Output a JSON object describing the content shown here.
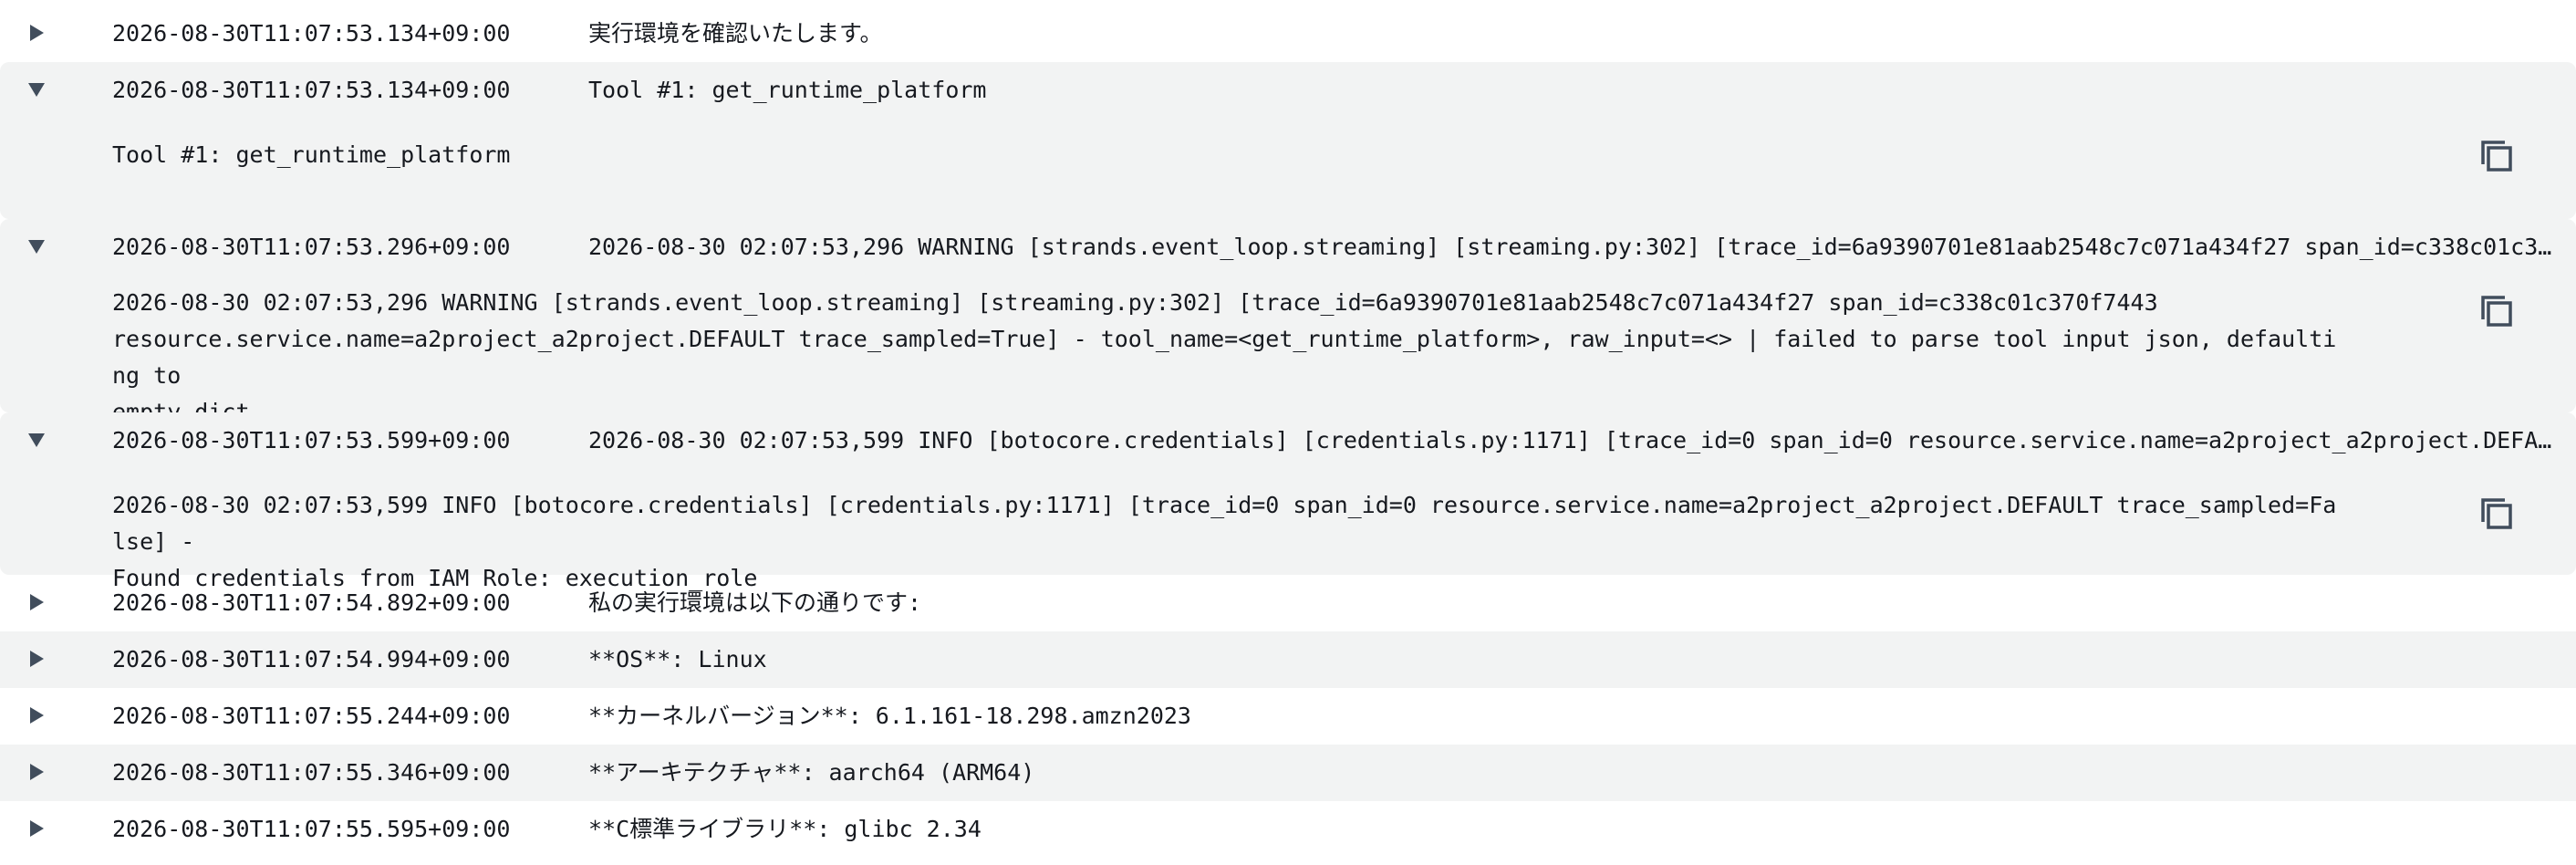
{
  "log": {
    "rows": [
      {
        "timestamp": "2026-08-30T11:07:53.134+09:00",
        "message": "実行環境を確認いたします。"
      },
      {
        "timestamp": "2026-08-30T11:07:53.134+09:00",
        "message": "Tool #1: get_runtime_platform",
        "detail": "Tool #1: get_runtime_platform"
      },
      {
        "timestamp": "2026-08-30T11:07:53.296+09:00",
        "message": "2026-08-30 02:07:53,296 WARNING [strands.event_loop.streaming] [streaming.py:302] [trace_id=6a9390701e81aab2548c7c071a434f27 span_id=c338c01c370f7443 resource.service.name=a2project_a2project.DEFAULT trace_sampled=True] - tool_name=<get_runtime_platform>, raw_input=<> | failed to parse tool input json, defaulting to empty dict",
        "detail": "2026-08-30 02:07:53,296 WARNING [strands.event_loop.streaming] [streaming.py:302] [trace_id=6a9390701e81aab2548c7c071a434f27 span_id=c338c01c370f7443\nresource.service.name=a2project_a2project.DEFAULT trace_sampled=True] - tool_name=<get_runtime_platform>, raw_input=<> | failed to parse tool input json, defaulting to\nempty dict"
      },
      {
        "timestamp": "2026-08-30T11:07:53.599+09:00",
        "message": "2026-08-30 02:07:53,599 INFO [botocore.credentials] [credentials.py:1171] [trace_id=0 span_id=0 resource.service.name=a2project_a2project.DEFAULT trace_sampled=False] - Found credentials from IAM Role: execution_role",
        "detail": "2026-08-30 02:07:53,599 INFO [botocore.credentials] [credentials.py:1171] [trace_id=0 span_id=0 resource.service.name=a2project_a2project.DEFAULT trace_sampled=False] -\nFound credentials from IAM Role: execution_role"
      },
      {
        "timestamp": "2026-08-30T11:07:54.892+09:00",
        "message": "私の実行環境は以下の通りです:"
      },
      {
        "timestamp": "2026-08-30T11:07:54.994+09:00",
        "message": "**OS**: Linux"
      },
      {
        "timestamp": "2026-08-30T11:07:55.244+09:00",
        "message": "**カーネルバージョン**: 6.1.161-18.298.amzn2023"
      },
      {
        "timestamp": "2026-08-30T11:07:55.346+09:00",
        "message": "**アーキテクチャ**: aarch64 (ARM64)"
      },
      {
        "timestamp": "2026-08-30T11:07:55.595+09:00",
        "message": "**C標準ライブラリ**: glibc 2.34"
      }
    ]
  },
  "icons": {
    "expand": "caret-right-icon",
    "collapse": "caret-down-icon",
    "copy": "copy-icon"
  }
}
